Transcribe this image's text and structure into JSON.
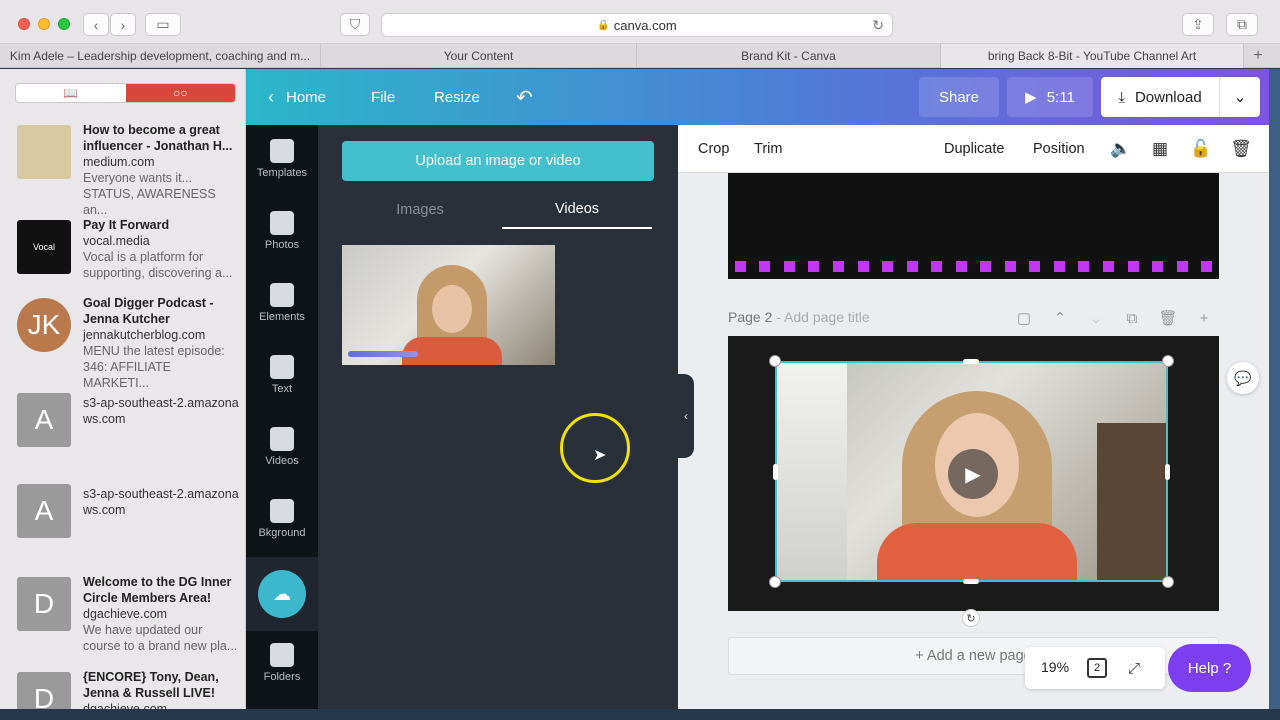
{
  "browser": {
    "address": "canva.com",
    "tabs": [
      "Kim Adele – Leadership development, coaching and m...",
      "Your Content",
      "Brand Kit - Canva",
      "bring Back 8-Bit - YouTube Channel Art"
    ],
    "new_tab": "+"
  },
  "reading_list": {
    "segment_left_icon": "book-icon",
    "segment_right_icon": "glasses-icon",
    "items": [
      {
        "thumb": "",
        "thumb_color": "#d9c9a0",
        "title": "How to become a great influencer - Jonathan H...",
        "source": "medium.com",
        "desc": "Everyone wants it... STATUS, AWARENESS an..."
      },
      {
        "thumb": "Vocal",
        "thumb_color": "#111111",
        "title": "Pay It Forward",
        "source": "vocal.media",
        "desc": "Vocal is a platform for supporting, discovering a..."
      },
      {
        "thumb": "JK",
        "thumb_color": "#b9794d",
        "title": "Goal Digger Podcast - Jenna Kutcher",
        "source": "jennakutcherblog.com",
        "desc": "MENU the latest episode: 346: AFFILIATE MARKETI..."
      },
      {
        "thumb": "A",
        "thumb_color": "#9a9a9a",
        "title": "",
        "source": "s3-ap-southeast-2.amazonaws.com",
        "desc": ""
      },
      {
        "thumb": "A",
        "thumb_color": "#9a9a9a",
        "title": "",
        "source": "s3-ap-southeast-2.amazonaws.com",
        "desc": ""
      },
      {
        "thumb": "D",
        "thumb_color": "#9a9a9a",
        "title": "Welcome to the DG Inner Circle Members Area!",
        "source": "dgachieve.com",
        "desc": "We have updated our course to a brand new pla..."
      },
      {
        "thumb": "D",
        "thumb_color": "#9a9a9a",
        "title": "{ENCORE} Tony, Dean, Jenna & Russell LIVE!",
        "source": "dgachieve.com",
        "desc": ""
      }
    ]
  },
  "canva": {
    "header": {
      "home": "Home",
      "file": "File",
      "resize": "Resize",
      "share": "Share",
      "duration": "5:11",
      "download": "Download"
    },
    "rail": [
      {
        "label": "Templates",
        "icon": "templates-icon"
      },
      {
        "label": "Photos",
        "icon": "photos-icon"
      },
      {
        "label": "Elements",
        "icon": "elements-icon"
      },
      {
        "label": "Text",
        "icon": "text-icon"
      },
      {
        "label": "Videos",
        "icon": "videos-icon"
      },
      {
        "label": "Bkground",
        "icon": "background-icon"
      },
      {
        "label": "Folders",
        "icon": "folders-icon"
      }
    ],
    "panel": {
      "upload_button": "Upload an image or video",
      "tab_images": "Images",
      "tab_videos": "Videos"
    },
    "toolbar": {
      "crop": "Crop",
      "trim": "Trim",
      "duplicate": "Duplicate",
      "position": "Position"
    },
    "page2": {
      "number": "Page 2",
      "title_placeholder": " - Add page title"
    },
    "add_page": "+ Add a new page",
    "zoom": "19%",
    "page_count": "2",
    "help": "Help ?"
  },
  "colors": {
    "accent": "#43bfcd",
    "help": "#7d3ef0",
    "header_start": "#2bb7c9",
    "header_end": "#7e53e0",
    "pixel_dots": "#c038f0"
  }
}
